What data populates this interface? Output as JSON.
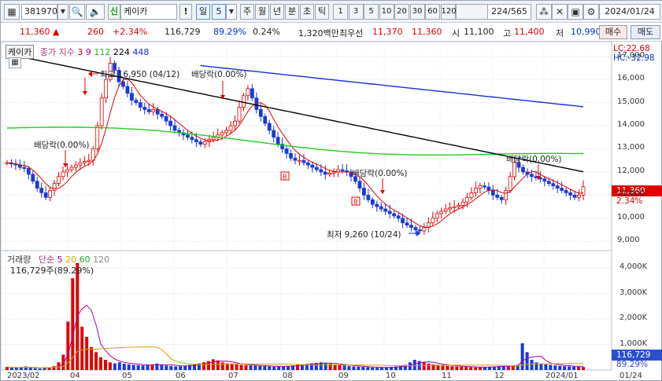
{
  "toolbar": {
    "code": "381970",
    "badge": "신",
    "name": "케이카",
    "alert": "!",
    "period": "일",
    "period_n": "5",
    "buttons": [
      "주",
      "월",
      "년",
      "분",
      "초",
      "틱"
    ],
    "intervals": [
      "1",
      "3",
      "5",
      "10",
      "20",
      "30",
      "60",
      "120"
    ],
    "count": "224/565",
    "date": "2024/01/24"
  },
  "quote": {
    "price": "11,360 ▲",
    "change": "260",
    "change_pct": "+2.34%",
    "volume": "116,729",
    "vol_ratio": "89.29%",
    "turnover": "0.24%",
    "amount": "1,320백만",
    "ask_label": "최우선",
    "ask1": "11,370",
    "bid1": "11,360",
    "open_label": "시",
    "open": "11,100",
    "high_label": "고",
    "high": "11,400",
    "low_label": "저",
    "low": "10,990",
    "buy": "매수",
    "sell": "매도"
  },
  "price_panel": {
    "stock_tag": "케이카",
    "legend_label": "종가 지수",
    "legend_values": [
      "3",
      "9",
      "112",
      "224",
      "448"
    ],
    "lc": "LC:22.68",
    "hc": "HC:-32.98",
    "current_price": "11,360",
    "current_pct": "2.34%",
    "annotations": {
      "high": "최고 16,950 (04/12)",
      "low": "최저 9,260 (10/24)",
      "div1": "배당락(0.00%)",
      "div2": "배당락(0.00%)",
      "div3": "배당락(0.00%)",
      "div4": "배당락(0.00%)"
    }
  },
  "volume_panel": {
    "label": "거래량",
    "legend_label": "단순",
    "legend_values": [
      "5",
      "20",
      "60",
      "120"
    ],
    "current": "116,729주(89.29%)",
    "current_box": "116,729",
    "current_box_pct": "89.29%"
  },
  "chart_data": {
    "type": "candlestick",
    "price_yticks": [
      "17,000",
      "16,000",
      "15,000",
      "14,000",
      "13,000",
      "12,000",
      "11,000",
      "10,000",
      "9,000"
    ],
    "volume_yticks": [
      "4,000K",
      "3,000K",
      "2,000K",
      "1,000K"
    ],
    "xticks": [
      "2023/02",
      "04",
      "05",
      "06",
      "07",
      "08",
      "09",
      "10",
      "11",
      "12",
      "2024/01",
      "01/24"
    ],
    "price_range": [
      8600,
      17500
    ],
    "moving_averages": {
      "ma224": "#000000",
      "ma448": "#1a2ed6",
      "ma112": "#22cc22",
      "ma9": "#e00000"
    },
    "closes": [
      12400,
      12350,
      12300,
      12200,
      12150,
      11900,
      11600,
      11300,
      11100,
      10900,
      11200,
      11500,
      11800,
      12000,
      12100,
      12200,
      12300,
      12400,
      12450,
      12500,
      13000,
      14000,
      15200,
      16000,
      16700,
      16400,
      15900,
      15700,
      15400,
      15100,
      15000,
      14800,
      14700,
      14600,
      14700,
      14500,
      14400,
      14200,
      14000,
      13800,
      13700,
      13600,
      13500,
      13400,
      13300,
      13200,
      13300,
      13400,
      13500,
      13600,
      13700,
      13800,
      14000,
      14200,
      14800,
      15300,
      15600,
      15200,
      14700,
      14400,
      14100,
      13800,
      13500,
      13200,
      13000,
      12800,
      12600,
      12500,
      12500,
      12400,
      12300,
      12200,
      12100,
      12000,
      11900,
      11950,
      12000,
      12100,
      12050,
      12000,
      11800,
      11600,
      11300,
      11000,
      10800,
      10600,
      10500,
      10400,
      10300,
      10200,
      10100,
      10000,
      9800,
      9700,
      9600,
      9500,
      9450,
      9600,
      9800,
      10000,
      10200,
      10300,
      10400,
      10450,
      10500,
      10550,
      10700,
      10900,
      11100,
      11300,
      11400,
      11350,
      11200,
      11000,
      10900,
      10800,
      11200,
      11800,
      12400,
      12200,
      12000,
      11900,
      11800,
      11750,
      11700,
      11600,
      11500,
      11400,
      11300,
      11200,
      11100,
      11000,
      10900,
      11000,
      11360
    ],
    "volumes_k": [
      120,
      90,
      80,
      110,
      140,
      90,
      70,
      60,
      80,
      100,
      150,
      300,
      600,
      1900,
      3600,
      4200,
      1700,
      1300,
      900,
      700,
      500,
      400,
      300,
      260,
      300,
      250,
      220,
      200,
      190,
      180,
      200,
      220,
      250,
      200,
      180,
      160,
      140,
      150,
      170,
      200,
      240,
      260,
      300,
      350,
      420,
      380,
      300,
      260,
      240,
      220,
      200,
      190,
      180,
      170,
      160,
      150,
      140,
      130,
      140,
      150,
      160,
      180,
      200,
      220,
      240,
      260,
      280,
      300,
      260,
      240,
      220,
      200,
      180,
      160,
      140,
      130,
      120,
      110,
      100,
      90,
      100,
      110,
      120,
      140,
      160,
      200,
      300,
      400,
      350,
      300,
      250,
      220,
      200,
      180,
      160,
      150,
      140,
      130,
      120,
      110,
      100,
      110,
      120,
      130,
      140,
      150,
      160,
      170,
      180,
      200,
      1050,
      700,
      400,
      300,
      250,
      220,
      200,
      180,
      160,
      150,
      140,
      130,
      120,
      117
    ]
  }
}
